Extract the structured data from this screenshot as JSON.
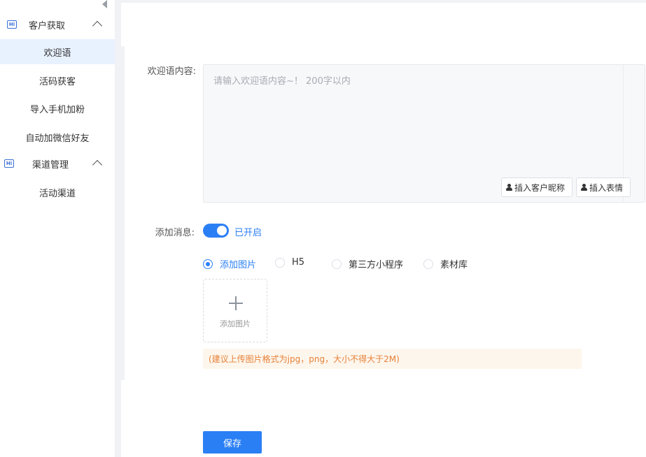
{
  "sidebar": {
    "groups": [
      {
        "label": "客户获取",
        "icon": "hi-icon",
        "expanded": true,
        "items": [
          {
            "label": "欢迎语",
            "active": true
          },
          {
            "label": "活码获客"
          },
          {
            "label": "导入手机加粉"
          },
          {
            "label": "自动加微信好友"
          }
        ]
      },
      {
        "label": "渠道管理",
        "icon": "hi-icon",
        "expanded": true,
        "items": [
          {
            "label": "活动渠道"
          }
        ]
      }
    ],
    "hi_text": "Hi"
  },
  "form": {
    "content_label": "欢迎语内容:",
    "content_placeholder": "请输入欢迎语内容~！ 200字以内",
    "insert_nickname": "插入客户昵称",
    "insert_emoji": "插入表情",
    "add_message_label": "添加消息:",
    "switch_text": "已开启",
    "switch_on": true,
    "radio_options": [
      "添加图片",
      "H5",
      "第三方小程序",
      "素材库"
    ],
    "selected_option": "添加图片",
    "upload_label": "添加图片",
    "tip": "(建议上传图片格式为jpg，png，大小不得大于2M)",
    "save_label": "保存"
  },
  "colors": {
    "accent": "#2b7ff5",
    "tip_text": "#e6813a",
    "tip_bg": "#fdf6ec",
    "active_bg": "#e8f1fe"
  }
}
